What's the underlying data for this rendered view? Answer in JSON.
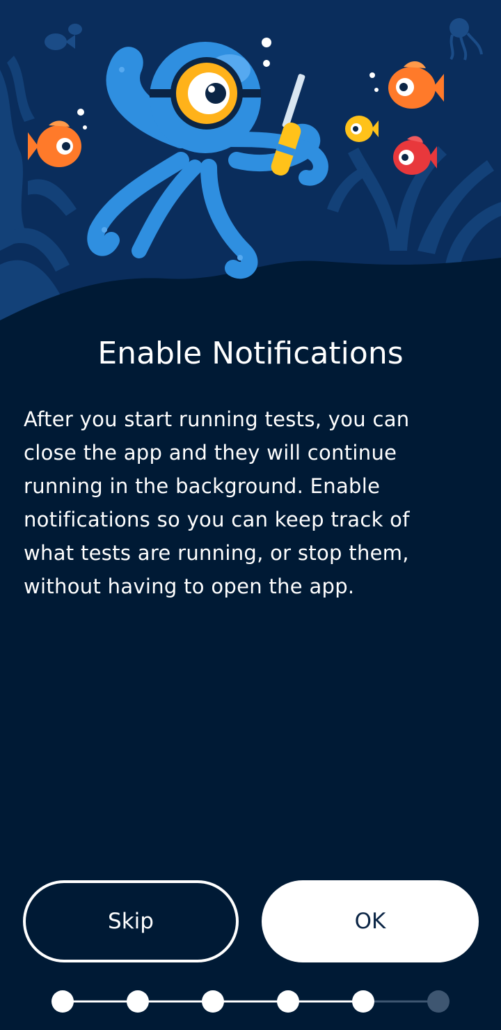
{
  "onboarding": {
    "title": "Enable Notifications",
    "body": "After you start running tests, you can\nclose the app and they will continue\nrunning in the background. Enable\nnotifications so you can keep track of\nwhat tests are running, or stop them,\nwithout having to open the app.",
    "skip_label": "Skip",
    "ok_label": "OK"
  },
  "progress": {
    "total_steps": 6,
    "current_step": 5
  },
  "illustration": {
    "subject": "octopus-diver-with-screwdriver-and-fish"
  },
  "colors": {
    "background": "#001a35",
    "sea": "#0a2d5c",
    "octopus": "#2f8fe0",
    "fish_orange": "#ff7a2a",
    "fish_red": "#e8383c",
    "fish_yellow": "#ffc21a",
    "button_text_dark": "#0b2545",
    "stepper_active": "#ffffff",
    "stepper_inactive": "#3e5671"
  }
}
